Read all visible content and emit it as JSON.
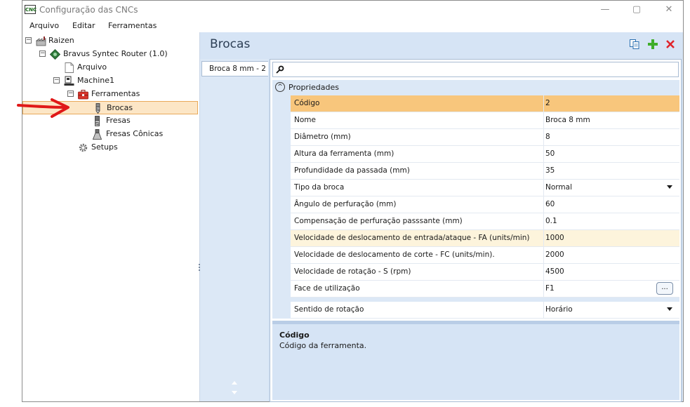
{
  "window": {
    "icon_text": "CNC",
    "title": "Configuração das CNCs",
    "controls": {
      "minimize": "—",
      "maximize": "▢",
      "close": "✕"
    }
  },
  "menu": [
    "Arquivo",
    "Editar",
    "Ferramentas"
  ],
  "tree": [
    {
      "label": "Raizen",
      "expander": "−",
      "icon": "factory-icon"
    },
    {
      "label": "Bravus Syntec Router (1.0)",
      "expander": "−",
      "icon": "router-gear-icon"
    },
    {
      "label": "Arquivo",
      "expander": "",
      "icon": "file-icon"
    },
    {
      "label": "Machine1",
      "expander": "−",
      "icon": "machine-icon"
    },
    {
      "label": "Ferramentas",
      "expander": "−",
      "icon": "toolbox-icon"
    },
    {
      "label": "Brocas",
      "expander": "",
      "icon": "drill-bit-icon",
      "selected": true
    },
    {
      "label": "Fresas",
      "expander": "",
      "icon": "end-mill-icon"
    },
    {
      "label": "Fresas Cônicas",
      "expander": "",
      "icon": "conical-mill-icon"
    },
    {
      "label": "Setups",
      "expander": "",
      "icon": "gear-icon"
    }
  ],
  "panel": {
    "title": "Brocas",
    "actions": [
      {
        "name": "copy-button",
        "icon": "copy-icon"
      },
      {
        "name": "add-button",
        "icon": "plus-icon",
        "color": "#3fae2a"
      },
      {
        "name": "delete-button",
        "icon": "close-icon",
        "color": "#e0242b"
      }
    ],
    "tabs": [
      {
        "label": "Broca 8 mm - 2"
      }
    ],
    "search": {
      "value": "",
      "placeholder": ""
    },
    "category": {
      "label": "Propriedades",
      "toggle": "^"
    },
    "properties": [
      {
        "name": "Código",
        "value": "2",
        "state": "selected"
      },
      {
        "name": "Nome",
        "value": "Broca 8 mm"
      },
      {
        "name": "Diâmetro (mm)",
        "value": "8"
      },
      {
        "name": "Altura da ferramenta (mm)",
        "value": "50"
      },
      {
        "name": "Profundidade da passada (mm)",
        "value": "35"
      },
      {
        "name": "Tipo da broca",
        "value": "Normal",
        "editor": "dropdown"
      },
      {
        "name": "Ângulo de perfuração (mm)",
        "value": "60"
      },
      {
        "name": "Compensação de perfuração passsante (mm)",
        "value": "0.1"
      },
      {
        "name": "Velocidade de deslocamento de entrada/ataque - FA (units/min)",
        "value": "1000",
        "state": "hover"
      },
      {
        "name": "Velocidade de deslocamento de corte - FC (units/min).",
        "value": "2000"
      },
      {
        "name": "Velocidade de rotação - S (rpm)",
        "value": "4500"
      },
      {
        "name": "Face de utilização",
        "value": "F1",
        "editor": "ellipsis",
        "button_label": "..."
      },
      {
        "name": "Sentido de rotação",
        "value": "Horário",
        "editor": "dropdown"
      }
    ],
    "description": {
      "title": "Código",
      "text": "Código da ferramenta."
    }
  },
  "colors": {
    "accent_selected": "#f8c67c",
    "tree_selected": "#fce6c6",
    "panel_bg": "#d6e4f5",
    "annotation_arrow": "#e01818"
  }
}
